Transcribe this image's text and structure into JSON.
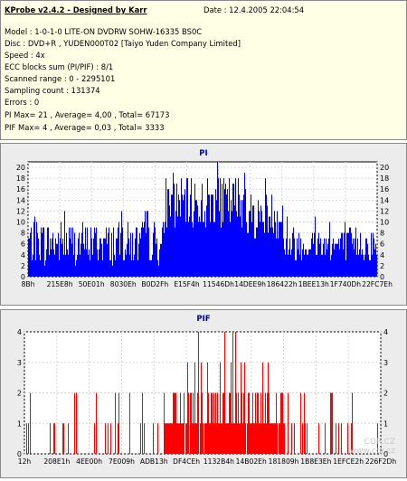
{
  "info": {
    "app_title": "KProbe v2.4.2 - Designed by Karr",
    "date_label": "Date : 12.4.2005 22:04:54",
    "lines": [
      "Model : 1-0-1-0 LITE-ON DVDRW SOHW-16335 BS0C",
      "Disc : DVD+R , YUDEN000T02 [Taiyo Yuden Company Limited]",
      "Speed : 4x",
      "ECC blocks sum (PI/PIF) : 8/1",
      "Scanned range : 0 - 2295101",
      "Sampling count : 131374",
      "Errors : 0",
      "PI Max= 21 , Average= 4,00 , Total= 67173",
      "PIF Max= 4 , Average= 0,03 , Total= 3333"
    ]
  },
  "chart_data": [
    {
      "type": "bar",
      "title": "PI",
      "color": "#0000ff",
      "ylim": [
        0,
        21
      ],
      "yticks": [
        0,
        2,
        4,
        6,
        8,
        10,
        12,
        14,
        16,
        18,
        20
      ],
      "xticks": [
        "8Bh",
        "215E8h",
        "50E01h",
        "8030Eh",
        "B0D2Fh",
        "E15F4h",
        "11546Dh",
        "14DEE9h",
        "186422h",
        "1BEE13h",
        "1F740Dh",
        "22FC7Eh"
      ],
      "segments": [
        {
          "from": 0.0,
          "to": 0.39,
          "base": 5,
          "noise": 4,
          "max": 12
        },
        {
          "from": 0.39,
          "to": 0.62,
          "base": 12,
          "noise": 5,
          "max": 21
        },
        {
          "from": 0.62,
          "to": 0.73,
          "base": 10,
          "noise": 4,
          "max": 18
        },
        {
          "from": 0.73,
          "to": 1.0,
          "base": 5,
          "noise": 3,
          "max": 11
        }
      ],
      "max": 21,
      "average": 4.0,
      "total": 67173
    },
    {
      "type": "bar",
      "title": "PIF",
      "color": "#ff0000",
      "ylim": [
        0,
        4
      ],
      "yticks": [
        0,
        1,
        2,
        3,
        4
      ],
      "xticks": [
        "12h",
        "208E1h",
        "4EE00h",
        "7E009h",
        "ADB13h",
        "DF4CEh",
        "1132B4h",
        "14B02Eh",
        "181809h",
        "1B8E3Eh",
        "1EFCE2h",
        "226F2Dh"
      ],
      "segments": [
        {
          "from": 0.0,
          "to": 0.39,
          "base": 0,
          "noise": 2,
          "max": 2
        },
        {
          "from": 0.39,
          "to": 0.73,
          "base": 1,
          "noise": 3,
          "max": 4
        },
        {
          "from": 0.73,
          "to": 1.0,
          "base": 0,
          "noise": 2,
          "max": 2
        }
      ],
      "max": 4,
      "average": 0.03,
      "total": 3333
    }
  ],
  "watermark": "CDR.CZ www.cdr.cz"
}
